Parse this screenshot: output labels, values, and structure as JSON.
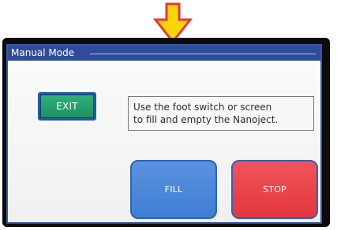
{
  "indicator": {
    "icon": "down-arrow-icon",
    "color": "#F7D50A",
    "outline": "#E53B2F"
  },
  "window": {
    "title": "Manual Mode"
  },
  "buttons": {
    "exit_label": "EXIT",
    "fill_label": "FILL",
    "stop_label": "STOP"
  },
  "message": {
    "line1": "Use the foot switch or screen",
    "line2": "to fill and empty the Nanoject."
  },
  "colors": {
    "exit": "#1E8F5E",
    "fill": "#3F7ED6",
    "stop": "#E3363D",
    "titlebar": "#2F4C9A"
  }
}
